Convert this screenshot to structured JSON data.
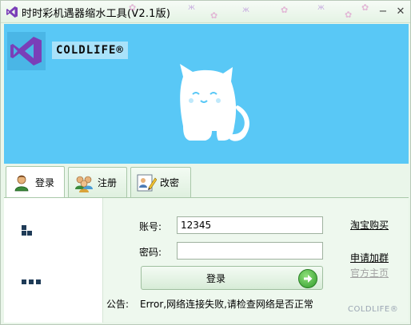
{
  "window": {
    "title": "时时彩机遇器缩水工具(V2.1版)",
    "minimize_glyph": "−",
    "close_glyph": "✕",
    "accent_color": "#59c8f6"
  },
  "banner": {
    "brand": "COLDLIFE®",
    "logo_icon": "visual-studio-icon",
    "illustration": "cat-icon"
  },
  "tabs": [
    {
      "label": "登录",
      "icon": "user-icon",
      "active": true
    },
    {
      "label": "注册",
      "icon": "users-icon",
      "active": false
    },
    {
      "label": "改密",
      "icon": "edit-icon",
      "active": false
    }
  ],
  "form": {
    "account_label": "账号:",
    "account_value": "12345",
    "password_label": "密码:",
    "password_value": "",
    "login_button": "登录"
  },
  "notice": {
    "label": "公告:",
    "text": "Error,网络连接失败,请检查网络是否正常"
  },
  "links": {
    "taobao": "淘宝购买",
    "join_group": "申请加群",
    "homepage": "官方主页"
  },
  "footer": {
    "watermark": "COLDLIFE®"
  }
}
